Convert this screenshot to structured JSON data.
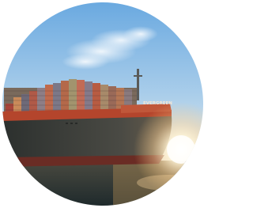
{
  "image": {
    "subject": "container-ship",
    "hull_marking": "EVERGREEN"
  },
  "colors": {
    "sky_top": "#7fb6e6",
    "sky_bottom": "#d9e7ef",
    "hull": "#3a3f3d",
    "hull_stripe": "#b0402a",
    "water": "#2c3a3c",
    "sun": "#fff4d6"
  }
}
